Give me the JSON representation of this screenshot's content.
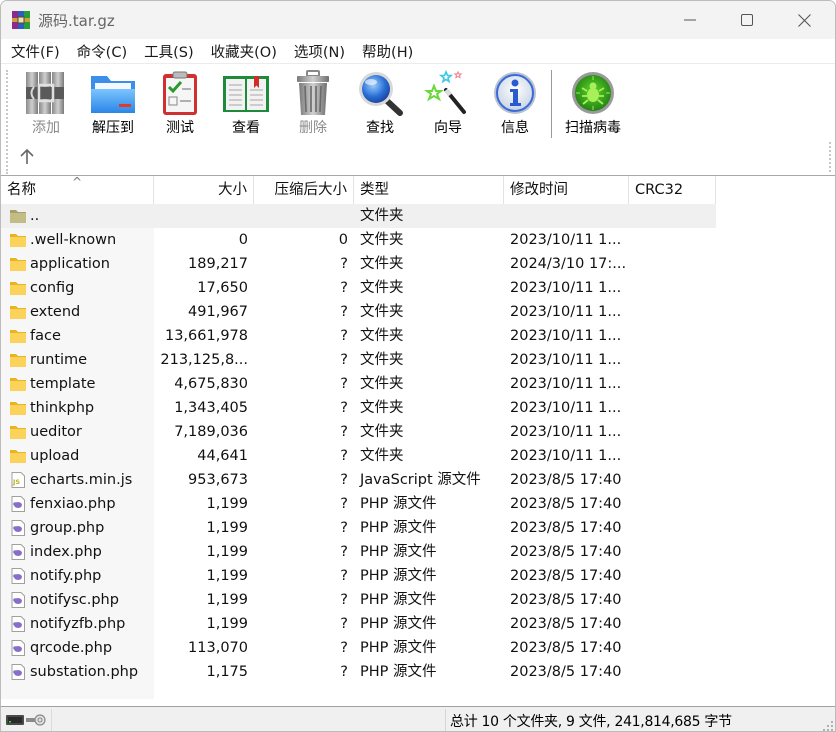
{
  "window": {
    "title": "源码.tar.gz",
    "controls": {
      "minimize": "minimize",
      "maximize": "maximize",
      "close": "close"
    }
  },
  "menu": [
    {
      "label": "文件(F)"
    },
    {
      "label": "命令(C)"
    },
    {
      "label": "工具(S)"
    },
    {
      "label": "收藏夹(O)"
    },
    {
      "label": "选项(N)"
    },
    {
      "label": "帮助(H)"
    }
  ],
  "toolbar": {
    "buttons": [
      {
        "label": "添加",
        "icon": "archive-add-icon",
        "enabled": false
      },
      {
        "label": "解压到",
        "icon": "extract-folder-icon",
        "enabled": true
      },
      {
        "label": "测试",
        "icon": "test-clipboard-icon",
        "enabled": true
      },
      {
        "label": "查看",
        "icon": "view-book-icon",
        "enabled": true
      },
      {
        "label": "删除",
        "icon": "trash-icon",
        "enabled": false
      },
      {
        "label": "查找",
        "icon": "magnifier-icon",
        "enabled": true
      },
      {
        "label": "向导",
        "icon": "wizard-wand-icon",
        "enabled": true
      },
      {
        "label": "信息",
        "icon": "info-icon",
        "enabled": true
      },
      {
        "label": "扫描病毒",
        "icon": "virus-scan-icon",
        "enabled": true
      }
    ],
    "up_icon": "up-arrow-icon"
  },
  "list": {
    "columns": [
      {
        "label": "名称"
      },
      {
        "label": "大小"
      },
      {
        "label": "压缩后大小"
      },
      {
        "label": "类型"
      },
      {
        "label": "修改时间"
      },
      {
        "label": "CRC32"
      }
    ],
    "sort_indicator": "^",
    "rows": [
      {
        "name": "..",
        "size": "",
        "packed": "",
        "type": "文件夹",
        "modified": "",
        "crc": "",
        "kind": "parent"
      },
      {
        "name": ".well-known",
        "size": "0",
        "packed": "0",
        "type": "文件夹",
        "modified": "2023/10/11 1...",
        "crc": "",
        "kind": "folder"
      },
      {
        "name": "application",
        "size": "189,217",
        "packed": "?",
        "type": "文件夹",
        "modified": "2024/3/10 17:...",
        "crc": "",
        "kind": "folder"
      },
      {
        "name": "config",
        "size": "17,650",
        "packed": "?",
        "type": "文件夹",
        "modified": "2023/10/11 1...",
        "crc": "",
        "kind": "folder"
      },
      {
        "name": "extend",
        "size": "491,967",
        "packed": "?",
        "type": "文件夹",
        "modified": "2023/10/11 1...",
        "crc": "",
        "kind": "folder"
      },
      {
        "name": "face",
        "size": "13,661,978",
        "packed": "?",
        "type": "文件夹",
        "modified": "2023/10/11 1...",
        "crc": "",
        "kind": "folder"
      },
      {
        "name": "runtime",
        "size": "213,125,8...",
        "packed": "?",
        "type": "文件夹",
        "modified": "2023/10/11 1...",
        "crc": "",
        "kind": "folder"
      },
      {
        "name": "template",
        "size": "4,675,830",
        "packed": "?",
        "type": "文件夹",
        "modified": "2023/10/11 1...",
        "crc": "",
        "kind": "folder"
      },
      {
        "name": "thinkphp",
        "size": "1,343,405",
        "packed": "?",
        "type": "文件夹",
        "modified": "2023/10/11 1...",
        "crc": "",
        "kind": "folder"
      },
      {
        "name": "ueditor",
        "size": "7,189,036",
        "packed": "?",
        "type": "文件夹",
        "modified": "2023/10/11 1...",
        "crc": "",
        "kind": "folder"
      },
      {
        "name": "upload",
        "size": "44,641",
        "packed": "?",
        "type": "文件夹",
        "modified": "2023/10/11 1...",
        "crc": "",
        "kind": "folder"
      },
      {
        "name": "echarts.min.js",
        "size": "953,673",
        "packed": "?",
        "type": "JavaScript 源文件",
        "modified": "2023/8/5 17:40",
        "crc": "",
        "kind": "js"
      },
      {
        "name": "fenxiao.php",
        "size": "1,199",
        "packed": "?",
        "type": "PHP 源文件",
        "modified": "2023/8/5 17:40",
        "crc": "",
        "kind": "php"
      },
      {
        "name": "group.php",
        "size": "1,199",
        "packed": "?",
        "type": "PHP 源文件",
        "modified": "2023/8/5 17:40",
        "crc": "",
        "kind": "php"
      },
      {
        "name": "index.php",
        "size": "1,199",
        "packed": "?",
        "type": "PHP 源文件",
        "modified": "2023/8/5 17:40",
        "crc": "",
        "kind": "php"
      },
      {
        "name": "notify.php",
        "size": "1,199",
        "packed": "?",
        "type": "PHP 源文件",
        "modified": "2023/8/5 17:40",
        "crc": "",
        "kind": "php"
      },
      {
        "name": "notifysc.php",
        "size": "1,199",
        "packed": "?",
        "type": "PHP 源文件",
        "modified": "2023/8/5 17:40",
        "crc": "",
        "kind": "php"
      },
      {
        "name": "notifyzfb.php",
        "size": "1,199",
        "packed": "?",
        "type": "PHP 源文件",
        "modified": "2023/8/5 17:40",
        "crc": "",
        "kind": "php"
      },
      {
        "name": "qrcode.php",
        "size": "113,070",
        "packed": "?",
        "type": "PHP 源文件",
        "modified": "2023/8/5 17:40",
        "crc": "",
        "kind": "php"
      },
      {
        "name": "substation.php",
        "size": "1,175",
        "packed": "?",
        "type": "PHP 源文件",
        "modified": "2023/8/5 17:40",
        "crc": "",
        "kind": "php"
      }
    ]
  },
  "status": {
    "summary": "总计 10 个文件夹, 9 文件, 241,814,685 字节",
    "icons": [
      "drive-icon",
      "key-icon"
    ]
  },
  "colors": {
    "folder": "#f7c948",
    "parent_folder": "#b8b27a",
    "php_icon": "#8a6fc9",
    "js_icon": "#b4b31e",
    "disabled_text": "#8a8a8a",
    "parent_row_bg": "#f0f0f0"
  }
}
